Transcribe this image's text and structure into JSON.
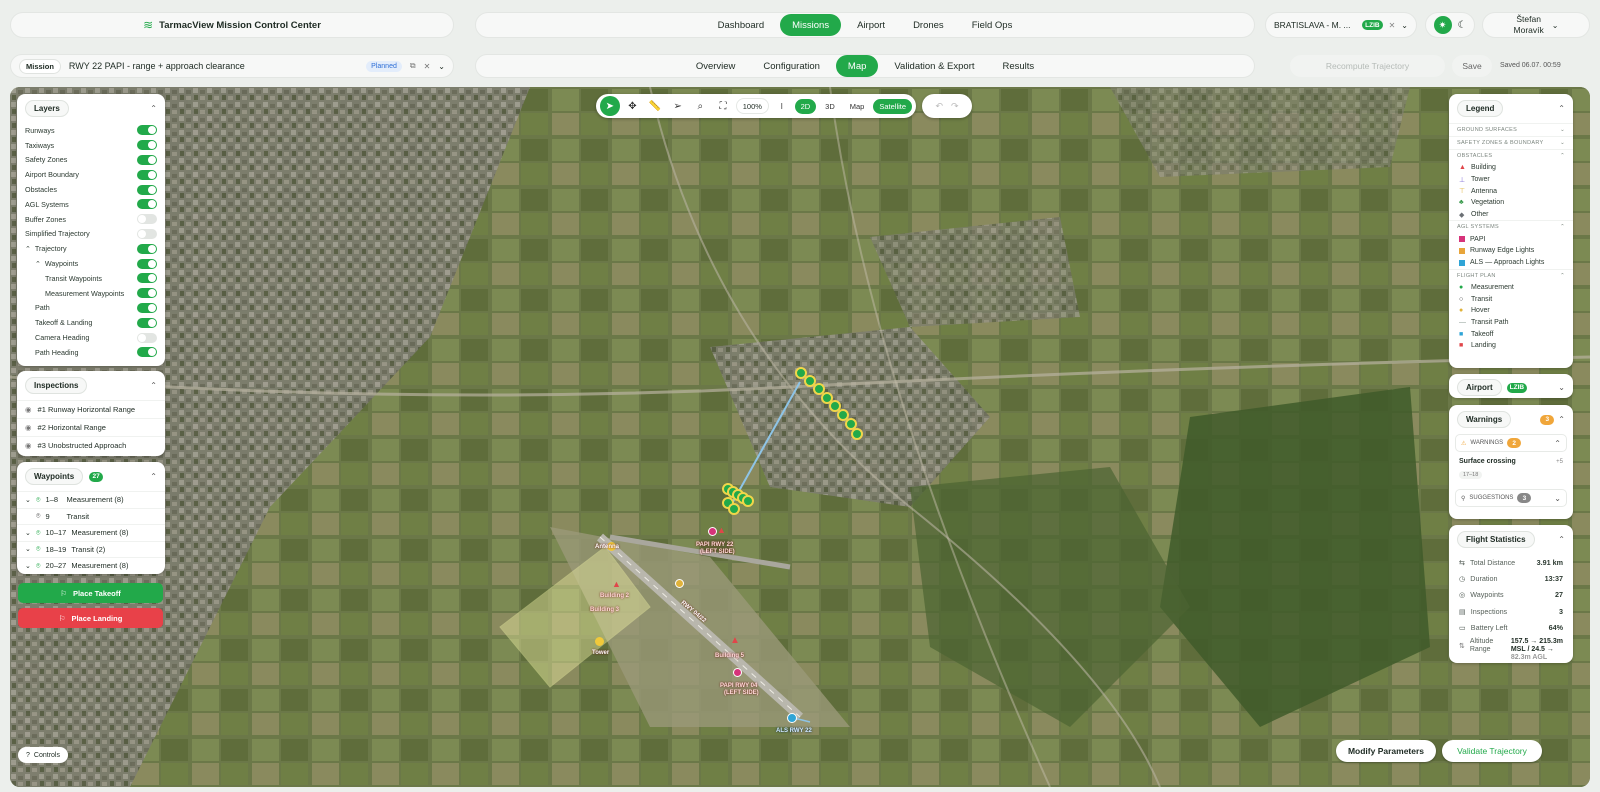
{
  "app": {
    "title": "TarmacView Mission Control Center",
    "nav": [
      "Dashboard",
      "Missions",
      "Airport",
      "Drones",
      "Field Ops"
    ],
    "nav_active": 1,
    "airport_selector": "BRATISLAVA - M. ...",
    "airport_code": "LZIB",
    "user_first": "Štefan",
    "user_last": "Moravík"
  },
  "mission": {
    "label": "Mission",
    "name": "RWY 22 PAPI - range + approach clearance",
    "status": "Planned",
    "tabs": [
      "Overview",
      "Configuration",
      "Map",
      "Validation & Export",
      "Results"
    ],
    "tab_active": 2,
    "recompute": "Recompute Trajectory",
    "save": "Save",
    "saved": "Saved 06.07. 00:59"
  },
  "toolbar": {
    "zoom": "100%",
    "mode_2d": "2D",
    "mode_3d": "3D",
    "map": "Map",
    "satellite": "Satellite"
  },
  "layers": {
    "title": "Layers",
    "items": [
      {
        "label": "Runways",
        "on": true,
        "indent": 0
      },
      {
        "label": "Taxiways",
        "on": true,
        "indent": 0
      },
      {
        "label": "Safety Zones",
        "on": true,
        "indent": 0
      },
      {
        "label": "Airport Boundary",
        "on": true,
        "indent": 0
      },
      {
        "label": "Obstacles",
        "on": true,
        "indent": 0
      },
      {
        "label": "AGL Systems",
        "on": true,
        "indent": 0
      },
      {
        "label": "Buffer Zones",
        "on": false,
        "indent": 0
      },
      {
        "label": "Simplified Trajectory",
        "on": false,
        "indent": 0
      },
      {
        "label": "Trajectory",
        "on": true,
        "indent": 0,
        "caret": true
      },
      {
        "label": "Waypoints",
        "on": true,
        "indent": 1,
        "caret": true
      },
      {
        "label": "Transit Waypoints",
        "on": true,
        "indent": 2
      },
      {
        "label": "Measurement Waypoints",
        "on": true,
        "indent": 2
      },
      {
        "label": "Path",
        "on": true,
        "indent": 1
      },
      {
        "label": "Takeoff & Landing",
        "on": true,
        "indent": 1
      },
      {
        "label": "Camera Heading",
        "on": false,
        "indent": 1
      },
      {
        "label": "Path Heading",
        "on": true,
        "indent": 1
      }
    ]
  },
  "inspections": {
    "title": "Inspections",
    "items": [
      "#1 Runway Horizontal Range",
      "#2 Horizontal Range",
      "#3 Unobstructed Approach"
    ]
  },
  "waypoints": {
    "title": "Waypoints",
    "count": "27",
    "items": [
      {
        "range": "1–8",
        "label": "Measurement (8)",
        "caret": true
      },
      {
        "range": "9",
        "label": "Transit",
        "caret": false
      },
      {
        "range": "10–17",
        "label": "Measurement (8)",
        "caret": true
      },
      {
        "range": "18–19",
        "label": "Transit (2)",
        "caret": true
      },
      {
        "range": "20–27",
        "label": "Measurement (8)",
        "caret": true
      }
    ],
    "place_takeoff": "Place Takeoff",
    "place_landing": "Place Landing"
  },
  "legend": {
    "title": "Legend",
    "sections": {
      "ground": "GROUND SURFACES",
      "safety": "SAFETY ZONES & BOUNDARY",
      "obstacles": "OBSTACLES",
      "agl": "AGL SYSTEMS",
      "flight": "FLIGHT PLAN"
    },
    "obstacles": [
      {
        "label": "Building",
        "color": "#e0464a",
        "shape": "▲"
      },
      {
        "label": "Tower",
        "color": "#7f6bd6",
        "shape": "⊥"
      },
      {
        "label": "Antenna",
        "color": "#e0b23a",
        "shape": "⊤"
      },
      {
        "label": "Vegetation",
        "color": "#3a9a4c",
        "shape": "♣"
      },
      {
        "label": "Other",
        "color": "#6b7075",
        "shape": "◆"
      }
    ],
    "agl": [
      {
        "label": "PAPI",
        "color": "#d6337a"
      },
      {
        "label": "Runway Edge Lights",
        "color": "#e8a53a"
      },
      {
        "label": "ALS — Approach Lights",
        "color": "#2fa4d6"
      }
    ],
    "flight": [
      {
        "label": "Measurement",
        "color": "#22a94a",
        "shape": "●"
      },
      {
        "label": "Transit",
        "color": "#333333",
        "shape": "○"
      },
      {
        "label": "Hover",
        "color": "#e0b23a",
        "shape": "●"
      },
      {
        "label": "Transit Path",
        "color": "#8a9a90",
        "shape": "—"
      },
      {
        "label": "Takeoff",
        "color": "#2fa4d6",
        "shape": "■"
      },
      {
        "label": "Landing",
        "color": "#e0464a",
        "shape": "■"
      }
    ]
  },
  "airport_panel": {
    "title": "Airport",
    "code": "LZIB"
  },
  "warnings": {
    "title": "Warnings",
    "count": "3",
    "warnings_label": "WARNINGS",
    "warnings_count": "2",
    "item_title": "Surface crossing",
    "item_meta": "+5",
    "item_tag": "17–18",
    "suggestions_label": "SUGGESTIONS",
    "suggestions_count": "3"
  },
  "flight_stats": {
    "title": "Flight Statistics",
    "rows": [
      {
        "label": "Total Distance",
        "value": "3.91 km",
        "icon": "⇆"
      },
      {
        "label": "Duration",
        "value": "13:37",
        "icon": "◷"
      },
      {
        "label": "Waypoints",
        "value": "27",
        "icon": "◎"
      },
      {
        "label": "Inspections",
        "value": "3",
        "icon": "▤"
      },
      {
        "label": "Battery Left",
        "value": "64%",
        "icon": "▭"
      }
    ],
    "altitude_label_1": "Altitude",
    "altitude_label_2": "Range",
    "altitude_line_1": "157.5 → 215.3m",
    "altitude_line_2": "MSL / 24.5 →",
    "altitude_line_3": "82.3m AGL"
  },
  "map_labels": {
    "papi_22_1": "PAPI RWY 22",
    "papi_22_2": "(LEFT SIDE)",
    "papi_04_1": "PAPI RWY 04",
    "papi_04_2": "(LEFT SIDE)",
    "als": "ALS RWY 22",
    "rwy": "RWY 04/22",
    "building_1": "Building 5",
    "building_2": "Building 2",
    "building_3": "Building 3",
    "tower": "Tower",
    "antenna": "Antenna"
  },
  "bottom": {
    "controls": "Controls",
    "modify": "Modify Parameters",
    "validate": "Validate Trajectory"
  }
}
